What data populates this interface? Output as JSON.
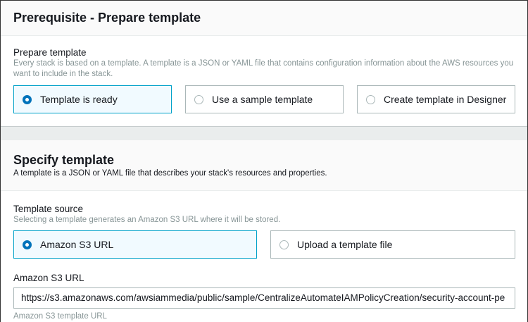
{
  "prerequisite": {
    "title": "Prerequisite - Prepare template",
    "field_label": "Prepare template",
    "description": "Every stack is based on a template. A template is a JSON or YAML file that contains configuration information about the AWS resources you want to include in the stack.",
    "options": [
      {
        "label": "Template is ready",
        "selected": true
      },
      {
        "label": "Use a sample template",
        "selected": false
      },
      {
        "label": "Create template in Designer",
        "selected": false
      }
    ]
  },
  "specify": {
    "title": "Specify template",
    "subtitle": "A template is a JSON or YAML file that describes your stack's resources and properties.",
    "source_label": "Template source",
    "source_description": "Selecting a template generates an Amazon S3 URL where it will be stored.",
    "options": [
      {
        "label": "Amazon S3 URL",
        "selected": true
      },
      {
        "label": "Upload a template file",
        "selected": false
      }
    ],
    "url_label": "Amazon S3 URL",
    "url_value": "https://s3.amazonaws.com/awsiammedia/public/sample/CentralizeAutomateIAMPolicyCreation/security-account-pe",
    "url_hint": "Amazon S3 template URL"
  }
}
